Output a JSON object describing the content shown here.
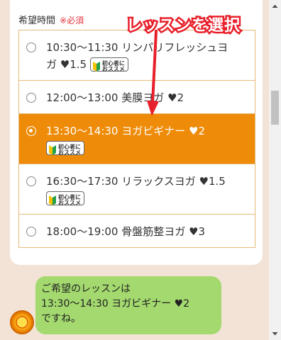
{
  "form": {
    "label": "希望時間",
    "required": "※必須",
    "options": [
      {
        "line1": "10:30〜11:30 リンパリフレッシュヨ",
        "line2": "ガ ♥1.5",
        "badge": "初心者に\nおススメ",
        "selected": false
      },
      {
        "line1": "12:00〜13:00 美膜ヨガ ♥2",
        "line2": "",
        "badge": "",
        "selected": false
      },
      {
        "line1": "13:30〜14:30 ヨガビギナー ♥2",
        "line2": "",
        "badge": "初心者に\nおススメ",
        "selected": true
      },
      {
        "line1": "16:30〜17:30 リラックスヨガ ♥1.5",
        "line2": "",
        "badge": "初心者に\nおススメ",
        "selected": false
      },
      {
        "line1": "18:00〜19:00 骨盤筋整ヨガ ♥3",
        "line2": "",
        "badge": "",
        "selected": false
      }
    ]
  },
  "annotation": {
    "text": "レッスンを選択",
    "color": "#e8202b"
  },
  "chat": {
    "lines": [
      "ご希望のレッスンは",
      "13:30〜14:30 ヨガビギナー ♥2",
      "ですね。"
    ]
  },
  "colors": {
    "accent": "#ee8b08",
    "bubble": "#a3d96e",
    "background": "#f2e3d6"
  }
}
